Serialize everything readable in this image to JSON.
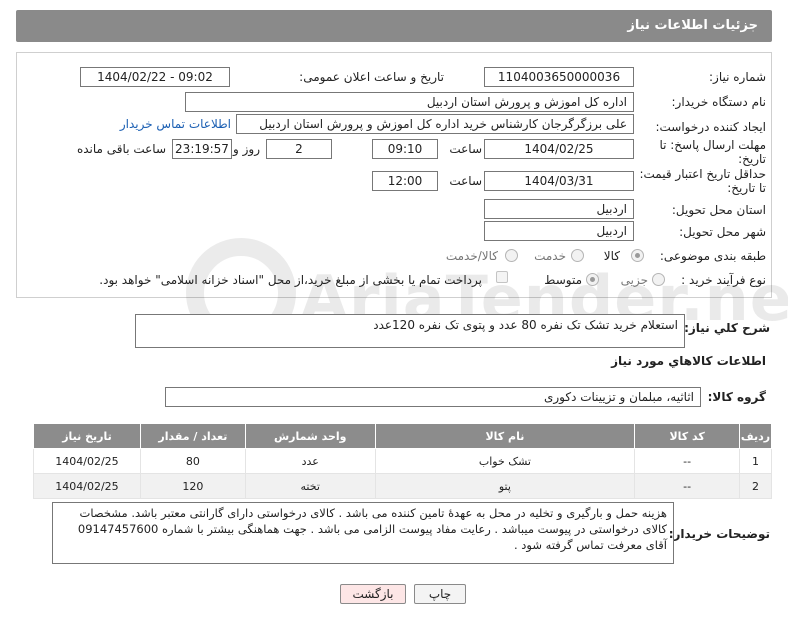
{
  "header": {
    "title": "جزئیات اطلاعات نیاز"
  },
  "form": {
    "need_number_label": "شماره نیاز:",
    "need_number": "1104003650000036",
    "announce_label": "تاریخ و ساعت اعلان عمومی:",
    "announce_value": "1404/02/22 - 09:02",
    "buyer_org_label": "نام دستگاه خریدار:",
    "buyer_org": "اداره کل اموزش و پرورش استان اردبیل",
    "requester_label": "ایجاد کننده درخواست:",
    "requester": "علی برزگرگرجان کارشناس خرید اداره کل اموزش و پرورش استان اردبیل",
    "contact_link": "اطلاعات تماس خریدار",
    "deadline_label": "مهلت ارسال پاسخ: تا تاریخ:",
    "deadline_date": "1404/02/25",
    "time_label": "ساعت",
    "deadline_time": "09:10",
    "days_value": "2",
    "days_label": "روز و",
    "remaining_time": "23:19:57",
    "remaining_label": "ساعت باقی مانده",
    "price_validity_label": "حداقل تاریخ اعتبار قیمت: تا تاریخ:",
    "price_validity_date": "1404/03/31",
    "price_validity_time": "12:00",
    "province_label": "استان محل تحویل:",
    "province": "اردبیل",
    "city_label": "شهر محل تحویل:",
    "city": "اردبیل",
    "category_label": "طبقه بندی موضوعی:",
    "category_options": [
      "کالا",
      "خدمت",
      "کالا/خدمت"
    ],
    "process_label": "نوع فرآیند خرید :",
    "process_options": [
      "جزیی",
      "متوسط"
    ],
    "payment_note": "پرداخت تمام یا بخشی از مبلغ خرید،از محل \"اسناد خزانه اسلامی\" خواهد بود."
  },
  "description": {
    "label": "شرح کلي نياز:",
    "text": "استعلام خرید تشک تک نفره 80 عدد و پتوی تک نفره 120عدد"
  },
  "goods": {
    "section_title": "اطلاعات کالاهاي مورد نياز",
    "group_label": "گروه کالا:",
    "group_value": "اثاثیه، مبلمان و تزیینات دکوری"
  },
  "table": {
    "headers": [
      "ردیف",
      "کد کالا",
      "نام کالا",
      "واحد شمارش",
      "تعداد / مقدار",
      "تاریخ نیاز"
    ],
    "rows": [
      [
        "1",
        "--",
        "تشک خواب",
        "عدد",
        "80",
        "1404/02/25"
      ],
      [
        "2",
        "--",
        "پتو",
        "تخته",
        "120",
        "1404/02/25"
      ]
    ]
  },
  "notes": {
    "label": "توضیحات خریدار:",
    "text": "هزینه حمل و بارگیری و تخلیه در محل به عهدهٔ تامین کننده می باشد . کالای درخواستی دارای گارانتی معتبر باشد. مشخصات کالای درخواستی در پیوست میباشد . رعایت مفاد پیوست الزامی می باشد . جهت هماهنگی بیشتر با شماره 09147457600 آقای معرفت تماس گرفته شود ."
  },
  "buttons": {
    "print": "چاپ",
    "back": "بازگشت"
  },
  "watermark": {
    "text": "AriaTender.net"
  },
  "colors": {
    "header_bg": "#8a8a8a",
    "link": "#1b5fb3",
    "back_button_bg": "#fde6e6"
  }
}
